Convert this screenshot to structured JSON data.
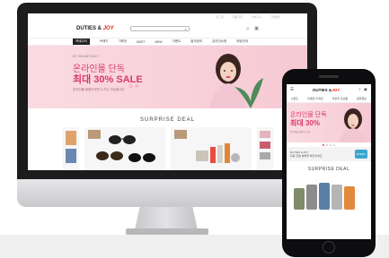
{
  "desktop": {
    "logo": {
      "main": "DUTIES &",
      "accent": "JOY"
    },
    "top_links": [
      "로그인",
      "회원가입",
      "장바구니",
      "고객센터"
    ],
    "nav": {
      "category_label": "카테고리",
      "items": [
        "브랜드",
        "기획전",
        "BEST",
        "NEW",
        "이벤트",
        "출국정보",
        "온라인쇼핑",
        "매장안내"
      ]
    },
    "banner": {
      "small": "BY ONLINE ONLY",
      "line1": "온라인몰 단독",
      "line2": "최대 30% SALE",
      "line3": "온라인몰 회원이라면 누구나 가능합니다"
    },
    "section_title": "SURPRISE DEAL"
  },
  "mobile": {
    "logo": {
      "main": "DUTIES &",
      "accent": "JOY"
    },
    "nav_items": [
      "브랜드",
      "이벤트/기획전",
      "이번주 신상품",
      "공항정보"
    ],
    "banner": {
      "line1": "온라인몰 단독",
      "line2": "최대 30%",
      "line3": "온라인몰 회원 누구나"
    },
    "promo": {
      "line1": "DUTIES & JOY",
      "line2": "회원 전용 혜택을 확인하세요",
      "badge": "EVENT"
    },
    "section_title": "SURPRISE DEAL"
  },
  "colors": {
    "accent": "#e2231a",
    "banner_pink": "#f6c9d3",
    "banner_text": "#d93a6a"
  },
  "icons": [
    "search-icon",
    "cart-icon",
    "user-icon",
    "menu-icon",
    "home-button"
  ]
}
